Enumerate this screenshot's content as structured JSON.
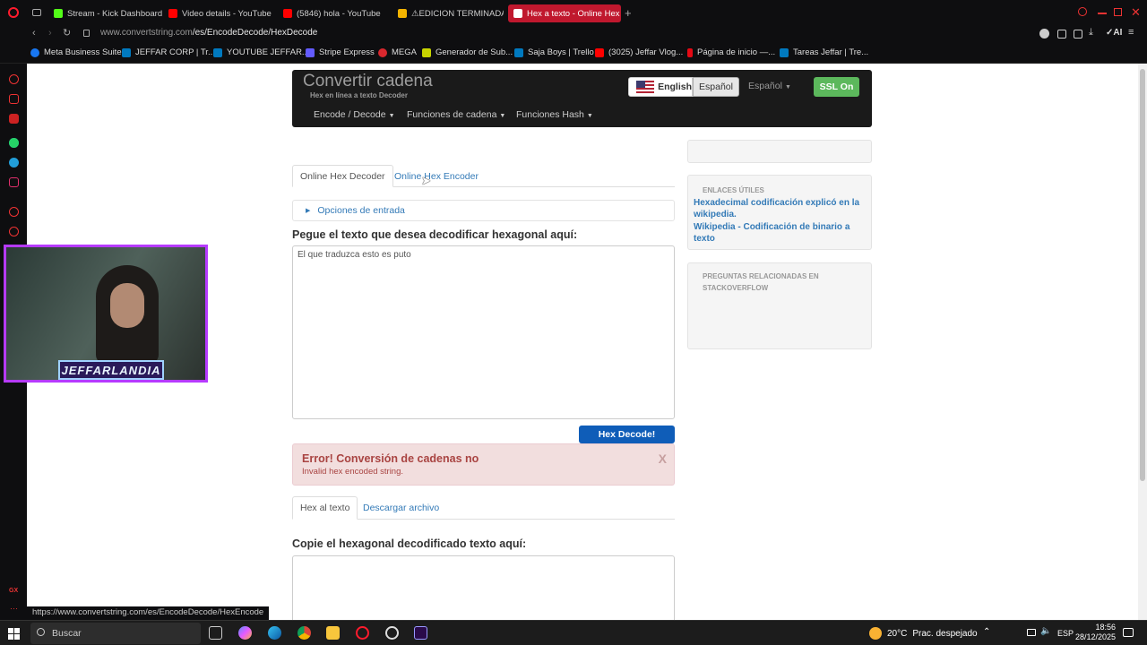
{
  "browser": {
    "tabs": [
      {
        "label": "Stream - Kick Dashboard",
        "color": "#53fc18"
      },
      {
        "label": "Video details - YouTube St",
        "color": "#ff0000"
      },
      {
        "label": "(5846) hola - YouTube",
        "color": "#ff0000"
      },
      {
        "label": "⚠EDICION TERMINADA⚠",
        "color": "#f4b400"
      },
      {
        "label": "Hex a texto - Online Hex D",
        "color": "#ffffff"
      }
    ],
    "address_prefix": "www.convertstring.com",
    "address_path": "/es/EncodeDecode/HexDecode",
    "bookmarks": [
      {
        "label": "Meta Business Suite",
        "color": "#1877f2"
      },
      {
        "label": "JEFFAR CORP | Tr...",
        "color": "#0079bf"
      },
      {
        "label": "YOUTUBE JEFFAR...",
        "color": "#0079bf"
      },
      {
        "label": "Stripe Express",
        "color": "#635bff"
      },
      {
        "label": "MEGA",
        "color": "#d9272e"
      },
      {
        "label": "Generador de Sub...",
        "color": "#c8d400"
      },
      {
        "label": "Saja Boys | Trello",
        "color": "#0079bf"
      },
      {
        "label": "(3025) Jeffar Vlog...",
        "color": "#ff0000"
      },
      {
        "label": "Página de inicio —...",
        "color": "#e50914"
      },
      {
        "label": "Tareas Jeffar | Tre...",
        "color": "#0079bf"
      }
    ],
    "status_url": "https://www.convertstring.com/es/EncodeDecode/HexEncode",
    "accent": "#c0182e"
  },
  "site": {
    "brand": "Convertir cadena",
    "brand_sub": "Hex en línea a texto Decoder",
    "nav": [
      "Encode / Decode",
      "Funciones de cadena",
      "Funciones Hash"
    ],
    "lang_english": "English",
    "lang_espanol": "Español",
    "lang_dropdown": "Español",
    "ssl": "SSL On"
  },
  "main": {
    "tab_decoder": "Online Hex Decoder",
    "tab_encoder": "Online Hex Encoder",
    "options_label": "Opciones de entrada",
    "input_heading": "Pegue el texto que desea decodificar hexagonal aquí:",
    "input_value": "El que traduzca esto es puto",
    "decode_button": "Hex Decode!",
    "error_title": "Error! Conversión de cadenas no",
    "error_detail": "Invalid hex encoded string.",
    "error_close": "X",
    "tab_hex_text": "Hex al texto",
    "tab_download": "Descargar archivo",
    "output_heading": "Copie el hexagonal decodificado texto aquí:",
    "output_value": ""
  },
  "side": {
    "links_title": "ENLACES ÚTILES",
    "link1": "Hexadecimal codificación explicó en la wikipedia.",
    "link2": "Wikipedia - Codificación de binario a texto",
    "questions_title": "PREGUNTAS RELACIONADAS EN STACKOVERFLOW"
  },
  "overlay": {
    "webcam_logo": "JEFFARLANDIA"
  },
  "taskbar": {
    "search": "Buscar",
    "weather_temp": "20°C",
    "weather_text": "Prac. despejado",
    "lang": "ESP",
    "time": "18:56",
    "date": "28/12/2025"
  }
}
